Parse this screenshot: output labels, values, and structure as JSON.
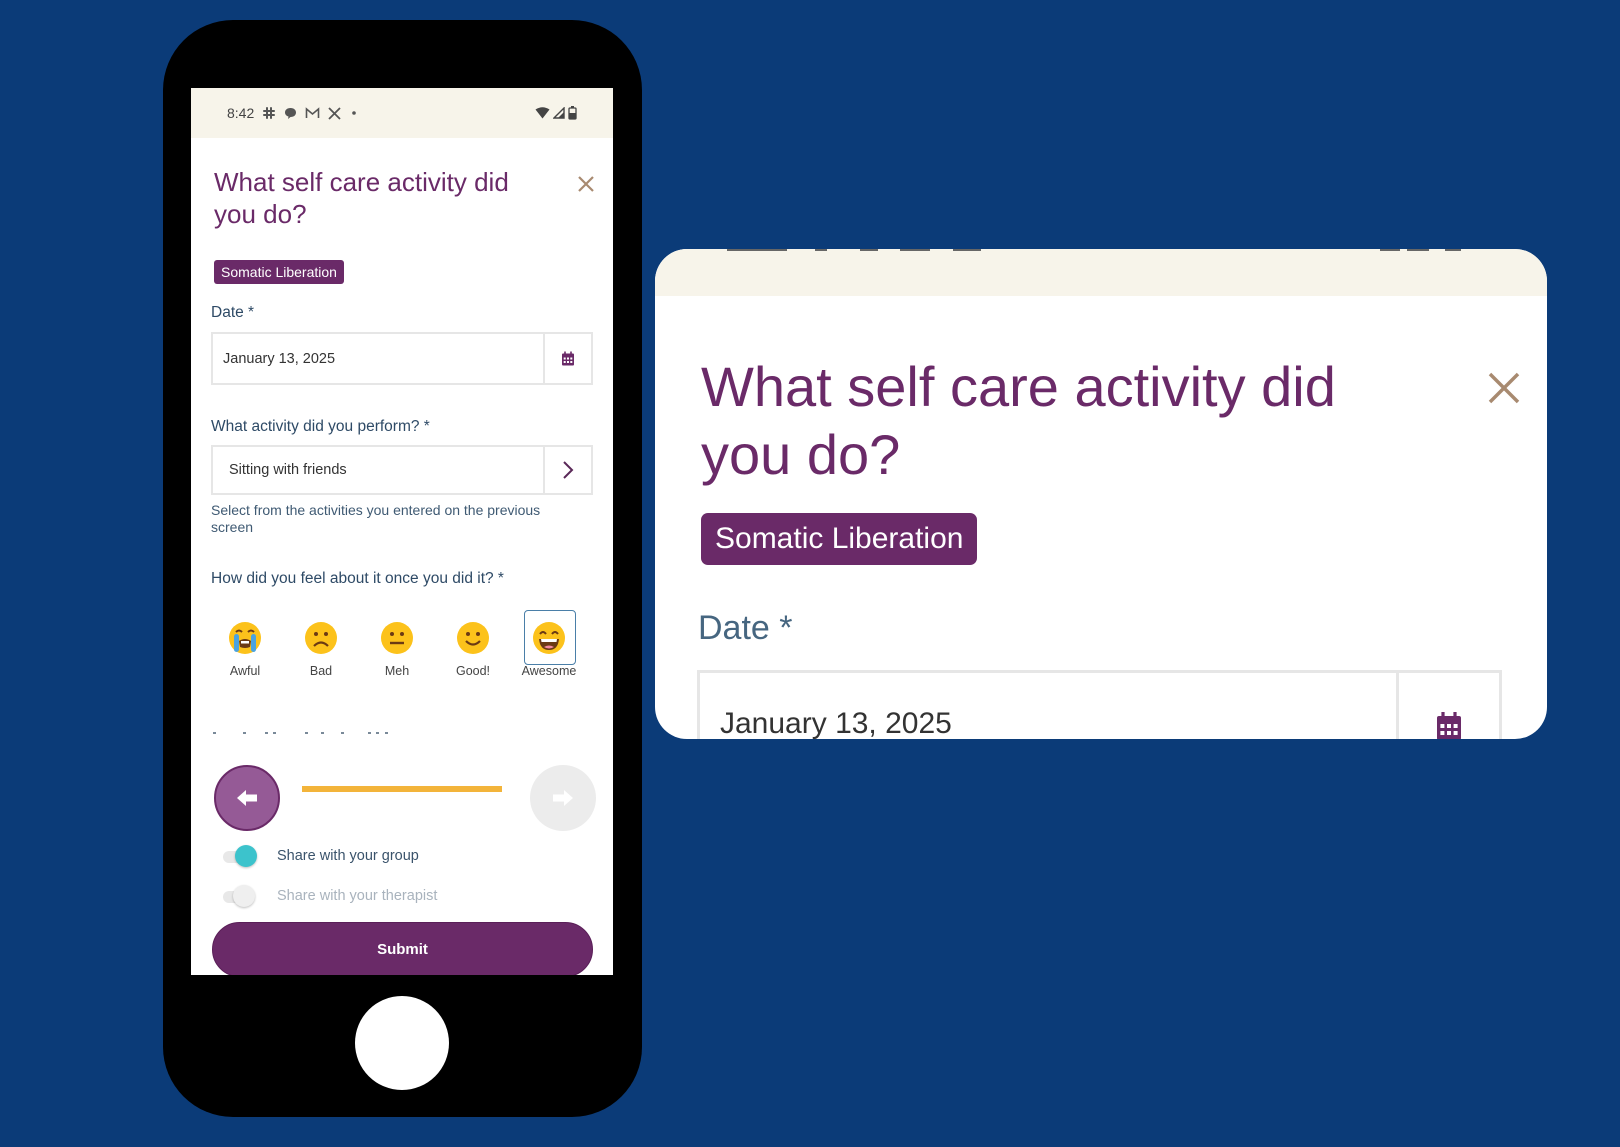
{
  "colors": {
    "background": "#0b3b78",
    "brand_purple": "#6a2a68",
    "status_bar": "#f7f4ea",
    "label_text": "#2e4a66",
    "progress_fill": "#f3b43a",
    "toggle_on": "#3cc3cc",
    "close_icon": "#a88a70"
  },
  "status_bar": {
    "time": "8:42",
    "left_icons": [
      "slack-icon",
      "chat-bubble-icon",
      "gmail-icon",
      "x-icon",
      "dot-icon"
    ],
    "right_icons": [
      "wifi-icon",
      "signal-icon",
      "battery-icon"
    ]
  },
  "form": {
    "title": "What self care activity did you do?",
    "close_icon": "close-icon",
    "tag": "Somatic Liberation",
    "date": {
      "label": "Date *",
      "value": "January 13, 2025",
      "icon": "calendar-icon"
    },
    "activity": {
      "label": "What activity did you perform? *",
      "value": "Sitting with friends",
      "icon": "chevron-right-icon",
      "helper": "Select from the activities you entered on the previous screen"
    },
    "feeling": {
      "label": "How did you feel about it once you did it? *",
      "options": [
        {
          "label": "Awful",
          "emoji": "😭",
          "selected": false
        },
        {
          "label": "Bad",
          "emoji": "🙁",
          "selected": false
        },
        {
          "label": "Meh",
          "emoji": "😐",
          "selected": false
        },
        {
          "label": "Good!",
          "emoji": "🙂",
          "selected": false
        },
        {
          "label": "Awesome",
          "emoji": "😄",
          "selected": true
        }
      ],
      "selected": "Awesome"
    },
    "navigation": {
      "back_icon": "arrow-left-icon",
      "forward_icon": "arrow-right-icon",
      "forward_enabled": false,
      "progress_percent": 100
    },
    "share_group": {
      "label": "Share with your group",
      "on": true
    },
    "share_therapist": {
      "label": "Share with your therapist",
      "on": false,
      "disabled": true
    },
    "submit_label": "Submit"
  },
  "zoom_card": {
    "title": "What self care activity did you do?",
    "tag": "Somatic Liberation",
    "date_label": "Date *",
    "date_value": "January 13, 2025"
  }
}
